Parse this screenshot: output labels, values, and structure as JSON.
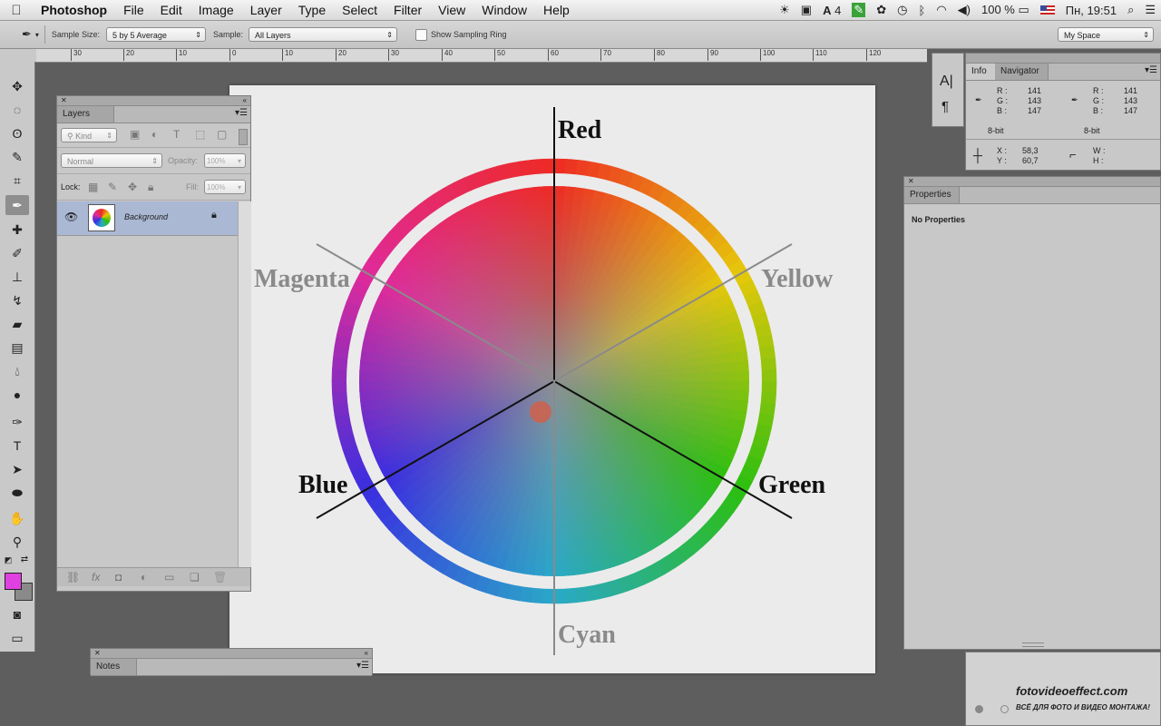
{
  "menubar": {
    "app": "Photoshop",
    "menus": [
      "File",
      "Edit",
      "Image",
      "Layer",
      "Type",
      "Select",
      "Filter",
      "View",
      "Window",
      "Help"
    ],
    "status": {
      "adobe_count": "4",
      "battery": "100 %",
      "clock": "Пн, 19:51"
    }
  },
  "options": {
    "sample_size_label": "Sample Size:",
    "sample_size_value": "5 by 5 Average",
    "sample_label": "Sample:",
    "sample_value": "All Layers",
    "sampling_ring_label": "Show Sampling Ring",
    "workspace": "My Space"
  },
  "ruler": {
    "ticks": [
      "30",
      "20",
      "10",
      "0",
      "10",
      "20",
      "30",
      "40",
      "50",
      "60",
      "70",
      "80",
      "90",
      "100",
      "110",
      "120"
    ]
  },
  "layers_panel": {
    "tab": "Layers",
    "filter_kind": "Kind",
    "blend_mode": "Normal",
    "opacity_label": "Opacity:",
    "opacity_value": "100%",
    "lock_label": "Lock:",
    "fill_label": "Fill:",
    "fill_value": "100%",
    "layer_name": "Background"
  },
  "notes_panel": {
    "tab": "Notes"
  },
  "info_panel": {
    "tabs": [
      "Info",
      "Navigator"
    ],
    "r_label": "R :",
    "g_label": "G :",
    "b_label": "B :",
    "r1": "141",
    "g1": "143",
    "b1": "147",
    "r2": "141",
    "g2": "143",
    "b2": "147",
    "bit1": "8-bit",
    "bit2": "8-bit",
    "x_label": "X :",
    "y_label": "Y :",
    "x": "58,3",
    "y": "60,7",
    "w_label": "W :",
    "h_label": "H :"
  },
  "properties_panel": {
    "tab": "Properties",
    "text": "No Properties"
  },
  "color_wheel": {
    "labels": {
      "red": "Red",
      "yellow": "Yellow",
      "green": "Green",
      "cyan": "Cyan",
      "blue": "Blue",
      "magenta": "Magenta"
    },
    "colors": {
      "red": "#ee2a24",
      "yellow": "#e6c80a",
      "green": "#2cbf10",
      "cyan": "#2aa8c8",
      "blue": "#3a2ee0",
      "magenta": "#e02a9a"
    }
  },
  "watermark": {
    "title": "fotovideoeffect.com",
    "subtitle": "ВСЁ ДЛЯ ФОТО И ВИДЕО МОНТАЖА!"
  },
  "swatches": {
    "foreground": "#e040e0",
    "background": "#8a8a8a"
  }
}
